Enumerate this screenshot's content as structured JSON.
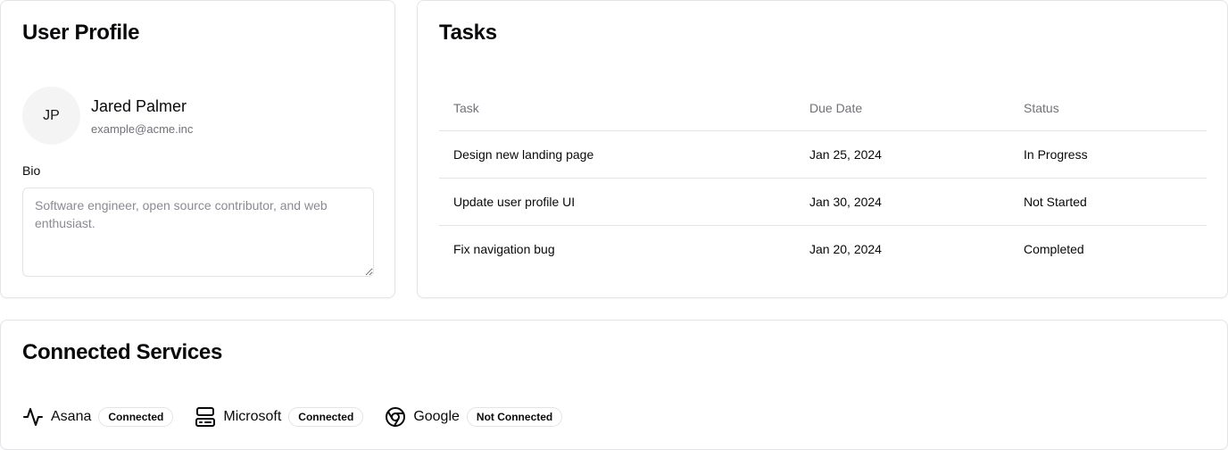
{
  "profile": {
    "title": "User Profile",
    "avatar_initials": "JP",
    "name": "Jared Palmer",
    "email": "example@acme.inc",
    "bio_label": "Bio",
    "bio_placeholder": "Software engineer, open source contributor, and web enthusiast.",
    "bio_value": ""
  },
  "tasks": {
    "title": "Tasks",
    "columns": [
      "Task",
      "Due Date",
      "Status"
    ],
    "rows": [
      {
        "task": "Design new landing page",
        "due": "Jan 25, 2024",
        "status": "In Progress"
      },
      {
        "task": "Update user profile UI",
        "due": "Jan 30, 2024",
        "status": "Not Started"
      },
      {
        "task": "Fix navigation bug",
        "due": "Jan 20, 2024",
        "status": "Completed"
      }
    ]
  },
  "services": {
    "title": "Connected Services",
    "items": [
      {
        "name": "Asana",
        "status": "Connected",
        "icon": "activity-icon"
      },
      {
        "name": "Microsoft",
        "status": "Connected",
        "icon": "microsoft-icon"
      },
      {
        "name": "Google",
        "status": "Not Connected",
        "icon": "chrome-icon"
      }
    ]
  }
}
